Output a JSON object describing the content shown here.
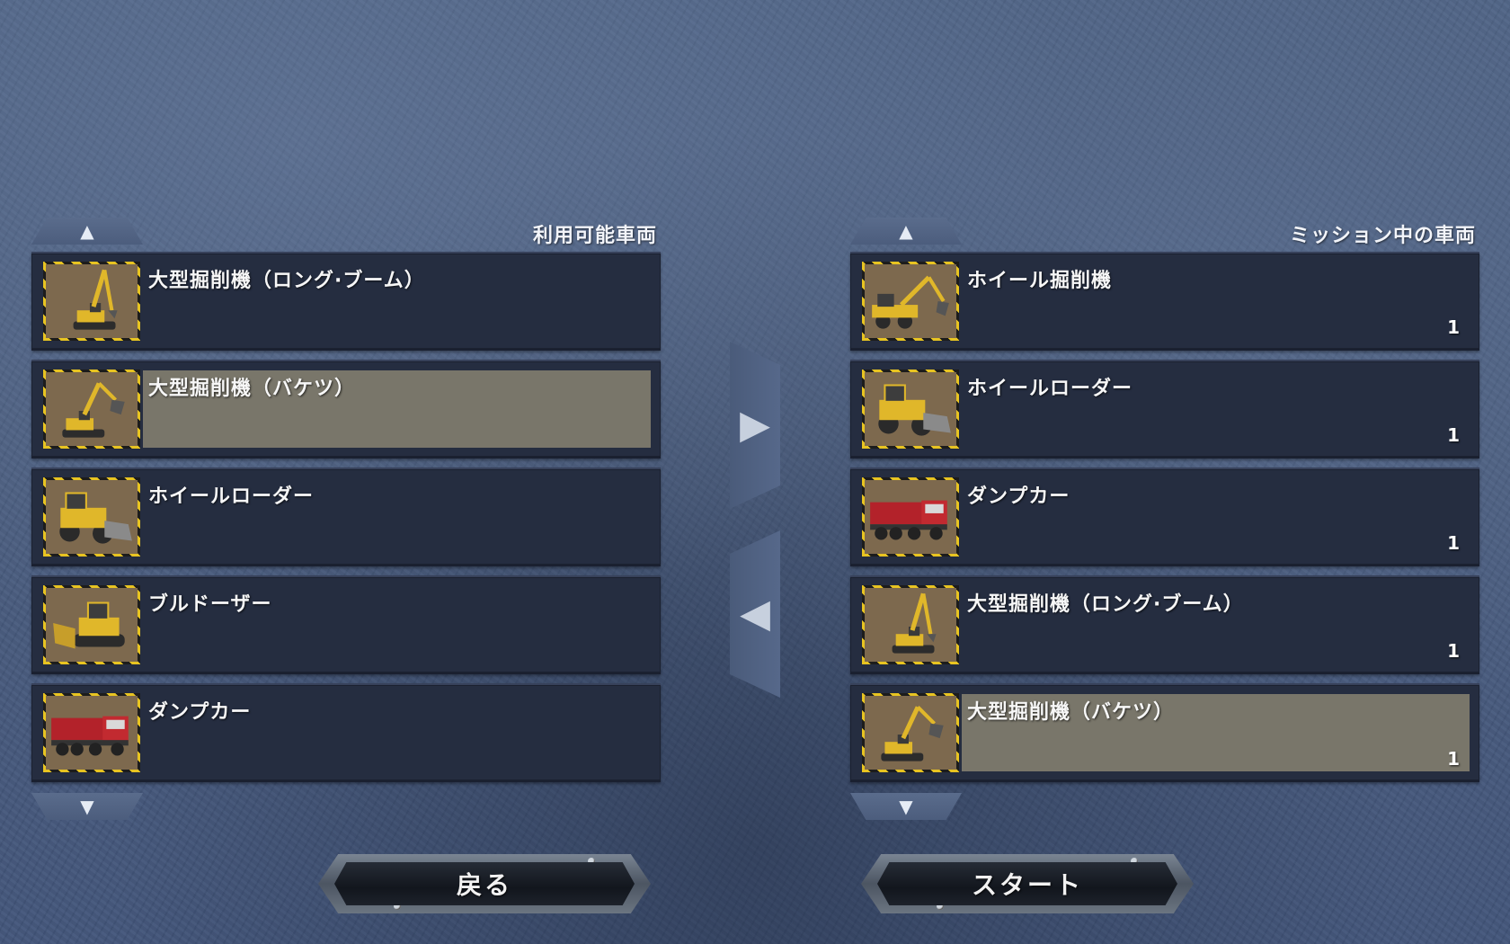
{
  "available": {
    "title": "利用可能車両",
    "items": [
      {
        "name": "大型掘削機（ロング·ブーム）",
        "icon": "long-boom-excavator-icon",
        "selected": false
      },
      {
        "name": "大型掘削機（バケツ）",
        "icon": "bucket-excavator-icon",
        "selected": true
      },
      {
        "name": "ホイールローダー",
        "icon": "wheel-loader-icon",
        "selected": false
      },
      {
        "name": "ブルドーザー",
        "icon": "bulldozer-icon",
        "selected": false
      },
      {
        "name": "ダンプカー",
        "icon": "dump-truck-icon",
        "selected": false
      }
    ]
  },
  "mission": {
    "title": "ミッション中の車両",
    "items": [
      {
        "name": "ホイール掘削機",
        "icon": "wheeled-excavator-icon",
        "count": "1",
        "selected": false
      },
      {
        "name": "ホイールローダー",
        "icon": "wheel-loader-icon",
        "count": "1",
        "selected": false
      },
      {
        "name": "ダンプカー",
        "icon": "dump-truck-icon",
        "count": "1",
        "selected": false
      },
      {
        "name": "大型掘削機（ロング·ブーム）",
        "icon": "long-boom-excavator-icon",
        "count": "1",
        "selected": false
      },
      {
        "name": "大型掘削機（バケツ）",
        "icon": "bucket-excavator-icon",
        "count": "1",
        "selected": true
      }
    ]
  },
  "buttons": {
    "back": "戻る",
    "start": "スタート",
    "scroll_up": "▲",
    "scroll_down": "▼",
    "add": "▶",
    "remove": "◀"
  },
  "colors": {
    "background": "#4a5d7e",
    "row": "#252d40",
    "row_selected": "#79766a",
    "hazard_yellow": "#e8c421",
    "machine_yellow": "#e0b72a",
    "truck_red": "#b3222a"
  }
}
